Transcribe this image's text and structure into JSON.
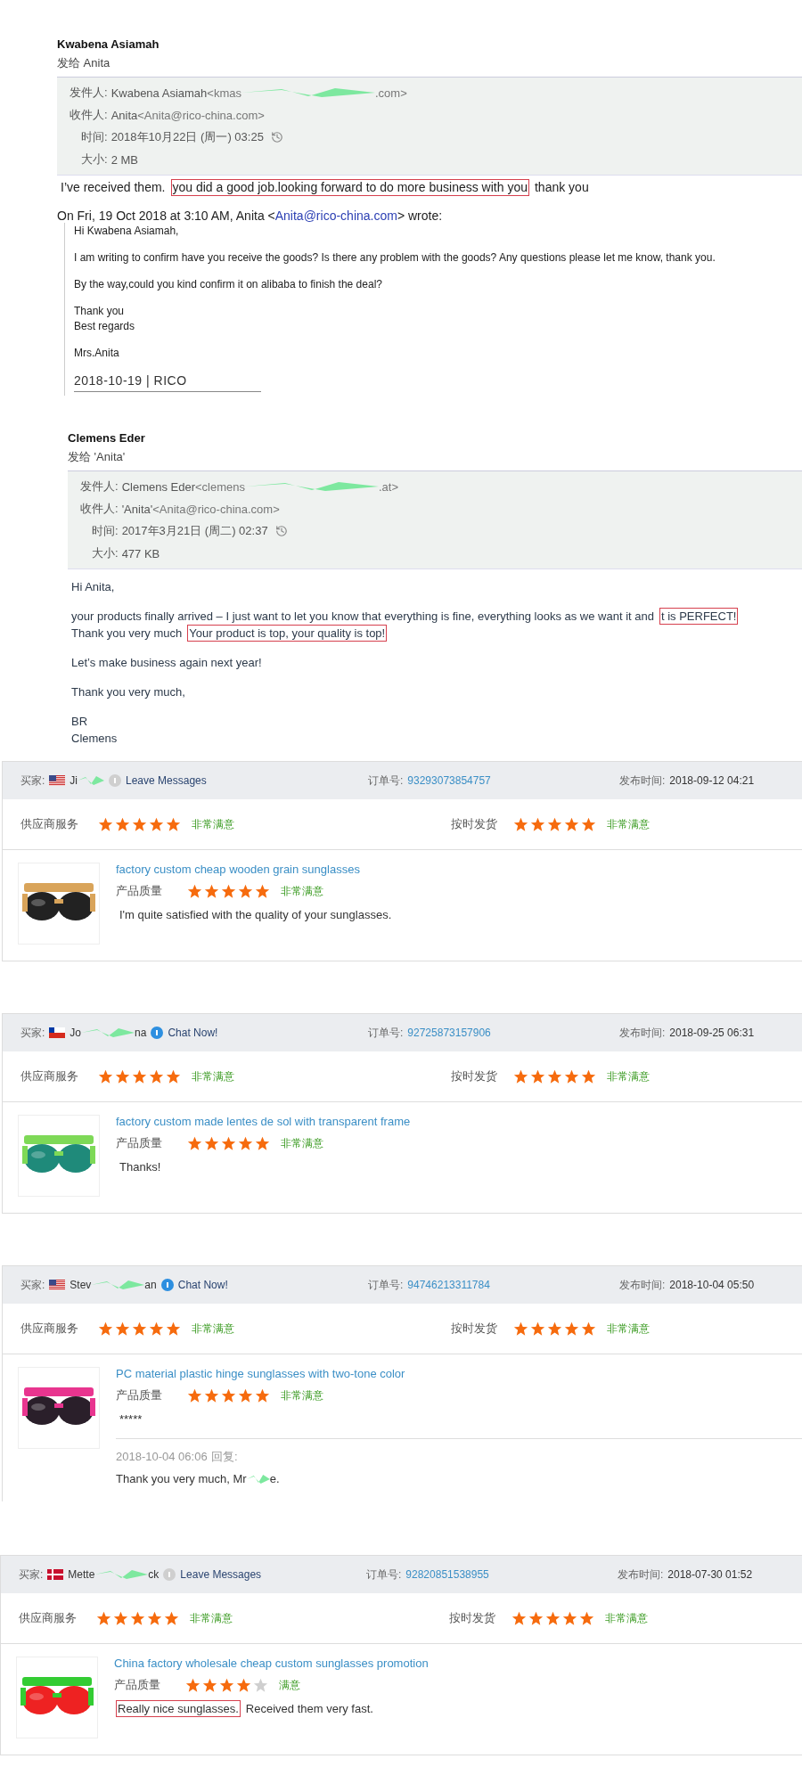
{
  "emails": [
    {
      "sender": "Kwabena Asiamah",
      "to_line": "发给 Anita",
      "meta": [
        {
          "label": "发件人:",
          "value": "Kwabena Asiamah",
          "address_start": "<kmas",
          "address_end": ".com>",
          "redacted": true,
          "history": false
        },
        {
          "label": "收件人:",
          "value": "Anita",
          "address_start": "<Anita@rico-china.com>",
          "redacted": false,
          "history": false
        },
        {
          "label": "时间:",
          "value": "2018年10月22日 (周一) 03:25",
          "redacted": false,
          "history": true
        },
        {
          "label": "大小:",
          "value": "2 MB",
          "redacted": false,
          "history": false
        }
      ],
      "body": [
        [
          [
            {
              "text": "I’ve received them.",
              "boxed": false
            },
            {
              "text": "you did a good job.looking forward to do more business with you",
              "boxed": true
            },
            {
              "text": "thank you",
              "boxed": false
            }
          ]
        ]
      ],
      "quote": {
        "intro_start": "On Fri, 19 Oct 2018 at 3:10 AM, Anita <",
        "intro_link": "Anita@rico-china.com",
        "intro_end": "> wrote:",
        "paragraphs": [
          [
            "Hi Kwabena Asiamah,"
          ],
          [
            "I am writing to confirm have you receive the goods? Is there any problem with the goods? Any questions please let me know, thank you."
          ],
          [
            "By the way,could you kind confirm it on alibaba to finish the deal?"
          ],
          [
            "Thank you",
            "Best regards"
          ],
          [
            "Mrs.Anita"
          ]
        ],
        "signature": "2018-10-19 | RICO"
      }
    },
    {
      "sender": "Clemens Eder",
      "to_line": "发给 'Anita'",
      "meta": [
        {
          "label": "发件人:",
          "value": "Clemens Eder",
          "address_start": "<clemens",
          "address_end": ".at>",
          "redacted": true,
          "history": false
        },
        {
          "label": "收件人:",
          "value": "'Anita'",
          "address_start": "<Anita@rico-china.com>",
          "redacted": false,
          "history": false
        },
        {
          "label": "时间:",
          "value": "2017年3月21日 (周二) 02:37",
          "redacted": false,
          "history": true
        },
        {
          "label": "大小:",
          "value": "477 KB",
          "redacted": false,
          "history": false
        }
      ],
      "body": [
        [
          [
            {
              "text": "Hi Anita,",
              "boxed": false
            }
          ]
        ],
        [
          [
            {
              "text": "your products finally arrived – I just want to let you know that everything is fine, everything looks as we want it and ",
              "boxed": false
            },
            {
              "text": "t is PERFECT!",
              "boxed": true
            }
          ],
          [
            {
              "text": "Thank you very much",
              "boxed": false
            },
            {
              "text": " Your product is top, your quality is top!",
              "boxed": true
            }
          ]
        ],
        [
          [
            {
              "text": "Let’s make business again next year!",
              "boxed": false
            }
          ]
        ],
        [
          [
            {
              "text": "Thank you very much,",
              "boxed": false
            }
          ]
        ],
        [
          [
            {
              "text": "BR",
              "boxed": false
            }
          ],
          [
            {
              "text": "Clemens",
              "boxed": false
            }
          ]
        ]
      ]
    }
  ],
  "reviews": [
    {
      "buyer_label": "买家:",
      "flag": {
        "kind": "us"
      },
      "name_start": "Ji",
      "online": false,
      "contact": "Leave Messages",
      "order_label": "订单号:",
      "order_number": "93293073854757",
      "time_label": "发布时间:",
      "time": "2018-09-12 04:21",
      "ratings": [
        {
          "label": "供应商服务",
          "stars": 5,
          "verdict": "非常满意"
        },
        {
          "label": "按时发货",
          "stars": 5,
          "verdict": "非常满意"
        }
      ],
      "product": {
        "kind": "picture",
        "title": "factory custom cheap wooden grain sunglasses",
        "quality_label": "产品质量",
        "stars": 5,
        "verdict": "非常满意",
        "comment": [
          {
            "text": "I'm quite satisfied with the quality of your sunglasses.",
            "boxed": false
          }
        ]
      }
    },
    {
      "buyer_label": "买家:",
      "flag": {
        "kind": "cl"
      },
      "name_start": "Jo",
      "name_end": "na",
      "online": true,
      "contact": "Chat Now!",
      "order_label": "订单号:",
      "order_number": "92725873157906",
      "time_label": "发布时间:",
      "time": "2018-09-25 06:31",
      "ratings": [
        {
          "label": "供应商服务",
          "stars": 5,
          "verdict": "非常满意"
        },
        {
          "label": "按时发货",
          "stars": 5,
          "verdict": "非常满意"
        }
      ],
      "product": {
        "kind": "picture",
        "title": "factory custom made lentes de sol with transparent frame",
        "quality_label": "产品质量",
        "stars": 5,
        "verdict": "非常满意",
        "comment": [
          {
            "text": "Thanks!",
            "boxed": false
          }
        ]
      }
    },
    {
      "buyer_label": "买家:",
      "flag": {
        "kind": "us"
      },
      "name_start": "Stev",
      "name_end": "an",
      "online": true,
      "contact": "Chat Now!",
      "order_label": "订单号:",
      "order_number": "94746213311784",
      "time_label": "发布时间:",
      "time": "2018-10-04 05:50",
      "ratings": [
        {
          "label": "供应商服务",
          "stars": 5,
          "verdict": "非常满意"
        },
        {
          "label": "按时发货",
          "stars": 5,
          "verdict": "非常满意"
        }
      ],
      "product": {
        "kind": "picture",
        "title": "PC material plastic hinge sunglasses with two-tone color",
        "quality_label": "产品质量",
        "stars": 5,
        "verdict": "非常满意",
        "comment": [
          {
            "text": "*****",
            "boxed": false
          }
        ],
        "reply": {
          "time": "2018-10-04 06:06",
          "label": "回复:",
          "text_start": "Thank you very much, Mr",
          "text_end": "e."
        }
      }
    },
    {
      "buyer_label": "买家:",
      "flag": {
        "kind": "dk"
      },
      "name_start": "Mette",
      "name_end": "ck",
      "online": false,
      "contact": "Leave Messages",
      "order_label": "订单号:",
      "order_number": "92820851538955",
      "time_label": "发布时间:",
      "time": "2018-07-30 01:52",
      "ratings": [
        {
          "label": "供应商服务",
          "stars": 5,
          "verdict": "非常满意"
        },
        {
          "label": "按时发货",
          "stars": 5,
          "verdict": "非常满意"
        }
      ],
      "product": {
        "kind": "picture",
        "title": "China factory wholesale cheap custom sunglasses promotion",
        "quality_label": "产品质量",
        "stars": 4,
        "verdict": "满意",
        "comment": [
          {
            "text": "Really nice sunglasses.",
            "boxed": true
          },
          {
            "text": " Received them very fast.",
            "boxed": false
          }
        ]
      }
    }
  ]
}
